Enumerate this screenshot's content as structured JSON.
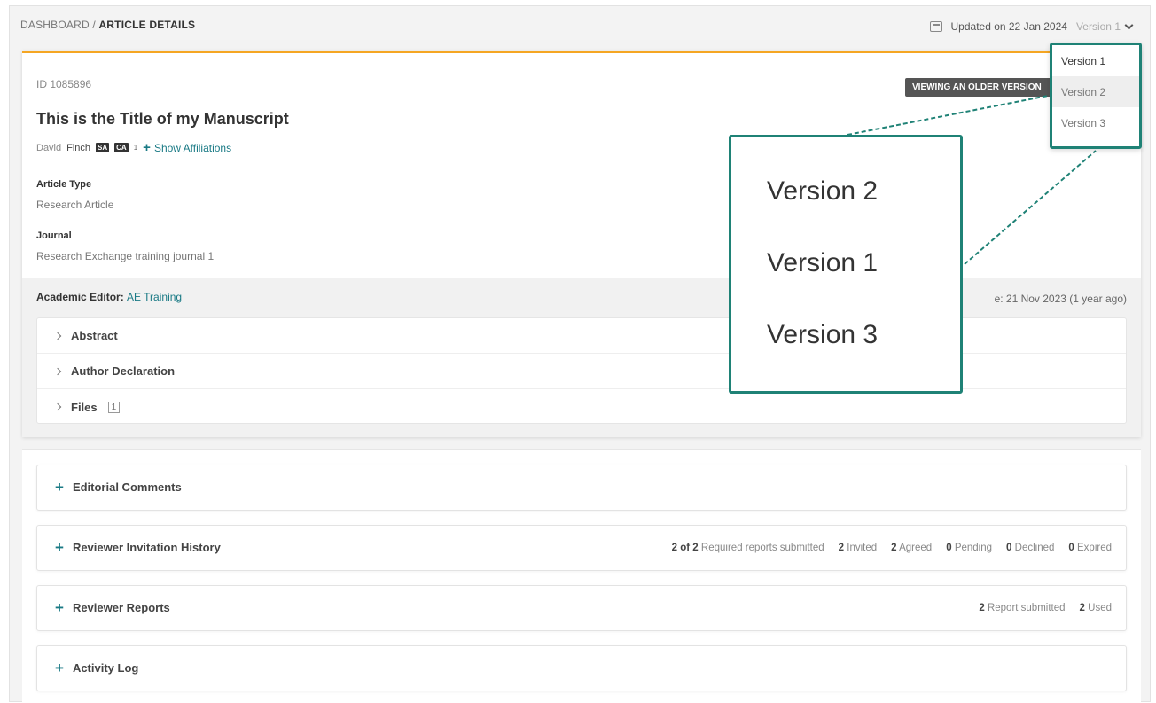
{
  "breadcrumb": {
    "parent": "DASHBOARD",
    "separator": " / ",
    "current": "ARTICLE DETAILS"
  },
  "header": {
    "updated": "Updated on 22 Jan 2024",
    "version_selected": "Version 1"
  },
  "article": {
    "id": "ID 1085896",
    "older_badge": "VIEWING AN OLDER VERSION",
    "title": "This is the Title of my Manuscript",
    "author_first": "David",
    "author_last": "Finch",
    "author_tags": [
      "SA",
      "CA"
    ],
    "author_sup": "1",
    "show_affiliations": "Show Affiliations",
    "type_label": "Article Type",
    "type_value": "Research Article",
    "journal_label": "Journal",
    "journal_value": "Research Exchange training journal 1"
  },
  "editor": {
    "label": "Academic Editor:",
    "name": "AE Training",
    "date_text": "e: 21 Nov 2023 (1 year ago)"
  },
  "accordion": [
    {
      "label": "Abstract"
    },
    {
      "label": "Author Declaration"
    },
    {
      "label": "Files",
      "count": "1"
    }
  ],
  "sections": {
    "editorial": {
      "title": "Editorial Comments"
    },
    "invitation": {
      "title": "Reviewer Invitation History",
      "stats": [
        {
          "n": "2 of 2",
          "t": "Required reports submitted"
        },
        {
          "n": "2",
          "t": "Invited"
        },
        {
          "n": "2",
          "t": "Agreed"
        },
        {
          "n": "0",
          "t": "Pending"
        },
        {
          "n": "0",
          "t": "Declined"
        },
        {
          "n": "0",
          "t": "Expired"
        }
      ]
    },
    "reports": {
      "title": "Reviewer Reports",
      "stats": [
        {
          "n": "2",
          "t": "Report submitted"
        },
        {
          "n": "2",
          "t": "Used"
        }
      ]
    },
    "activity": {
      "title": "Activity Log"
    }
  },
  "version_dropdown": [
    "Version 1",
    "Version 2",
    "Version 3"
  ],
  "zoom_callout": [
    "Version 2",
    "Version 1",
    "Version 3"
  ],
  "colors": {
    "accent": "#f5a623",
    "teal": "#1a7a85",
    "highlight_border": "#1f8276"
  }
}
